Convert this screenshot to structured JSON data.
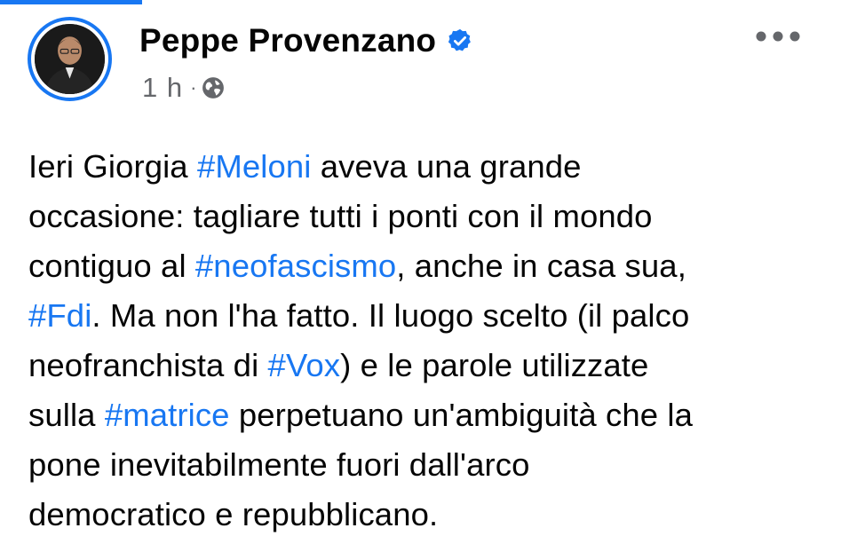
{
  "author": {
    "name": "Peppe Provenzano",
    "verified": true,
    "avatar_icon": "profile-photo"
  },
  "meta": {
    "time": "1 h",
    "separator": "·",
    "privacy_icon": "globe-icon"
  },
  "actions": {
    "more_icon": "more-horizontal-icon"
  },
  "post": {
    "hashtag_color": "#1877f2",
    "lines": [
      [
        {
          "t": "Ieri Giorgia "
        },
        {
          "t": "#Meloni",
          "h": true
        },
        {
          "t": " aveva una grande"
        }
      ],
      [
        {
          "t": "occasione: tagliare tutti i ponti con il mondo"
        }
      ],
      [
        {
          "t": "contiguo al "
        },
        {
          "t": "#neofascismo",
          "h": true
        },
        {
          "t": ", anche in casa sua,"
        }
      ],
      [
        {
          "t": "#Fdi",
          "h": true
        },
        {
          "t": ". Ma non l'ha fatto. Il luogo scelto (il palco"
        }
      ],
      [
        {
          "t": "neofranchista di "
        },
        {
          "t": "#Vox",
          "h": true
        },
        {
          "t": ") e le parole utilizzate"
        }
      ],
      [
        {
          "t": "sulla "
        },
        {
          "t": "#matrice",
          "h": true
        },
        {
          "t": " perpetuano un'ambiguità che la"
        }
      ],
      [
        {
          "t": "pone inevitabilmente fuori dall'arco"
        }
      ],
      [
        {
          "t": "democratico e repubblicano."
        }
      ]
    ]
  },
  "colors": {
    "accent": "#1877f2",
    "text": "#050505",
    "secondary": "#65676b"
  }
}
